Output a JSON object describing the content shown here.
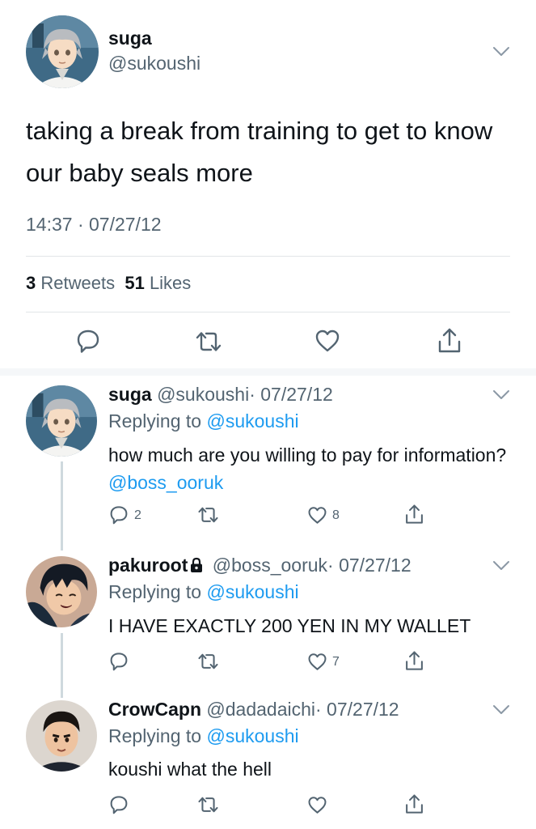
{
  "main_tweet": {
    "name": "suga",
    "handle": "@sukoushi",
    "text": "taking a break from training to get to know our baby seals more",
    "timestamp": "14:37 · 07/27/12",
    "retweets_count": "3",
    "retweets_label": "Retweets",
    "likes_count": "51",
    "likes_label": "Likes"
  },
  "replies": [
    {
      "name": "suga",
      "handle": "@sukoushi",
      "date": "· 07/27/12",
      "replying_prefix": "Replying to",
      "replying_to": "@sukoushi",
      "text": "how much are you willing to pay for information?",
      "mention": "@boss_ooruk",
      "reply_count": "2",
      "like_count": "8"
    },
    {
      "name": "pakuroot",
      "handle": "@boss_ooruk",
      "date": "· 07/27/12",
      "replying_prefix": "Replying to",
      "replying_to": "@sukoushi",
      "text": "I HAVE EXACTLY 200 YEN IN MY WALLET",
      "like_count": "7"
    },
    {
      "name": "CrowCapn",
      "handle": "@dadadaichi",
      "date": "· 07/27/12",
      "replying_prefix": "Replying to",
      "replying_to": "@sukoushi",
      "text": "koushi what the hell"
    }
  ],
  "colors": {
    "link": "#1d9bf0",
    "secondary": "#536471",
    "divider": "#e1e5e8"
  },
  "icons": [
    "chevron-down-icon",
    "reply-icon",
    "retweet-icon",
    "like-icon",
    "share-icon",
    "lock-icon"
  ]
}
